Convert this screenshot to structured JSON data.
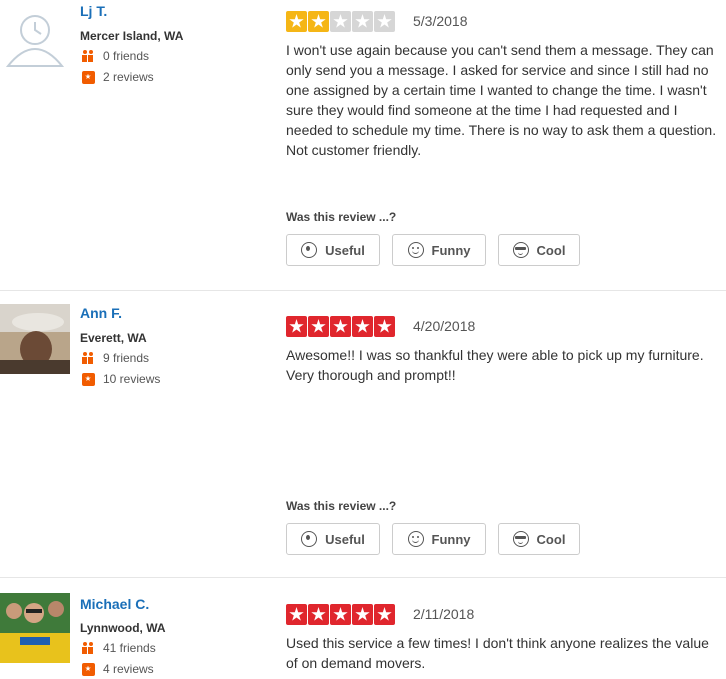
{
  "reviews": [
    {
      "user": {
        "name": "Lj T.",
        "location": "Mercer Island, WA",
        "friends": "0 friends",
        "reviews": "2 reviews",
        "avatar": "default-avatar"
      },
      "rating": 2,
      "star_color": "#f5b616",
      "date": "5/3/2018",
      "text": "I won't use again because you can't send them a message. They can only send you a message. I asked for service and since I still had no one assigned by a certain time I wanted to change the time. I wasn't sure they would find someone at the time I had requested and I needed to schedule my time. There is no way to ask them a question. Not customer friendly.",
      "was_this": "Was this review ...?",
      "buttons": {
        "useful": "Useful",
        "funny": "Funny",
        "cool": "Cool"
      }
    },
    {
      "user": {
        "name": "Ann F.",
        "location": "Everett, WA",
        "friends": "9 friends",
        "reviews": "10 reviews",
        "avatar": "user-photo"
      },
      "rating": 5,
      "star_color": "#e0262d",
      "date": "4/20/2018",
      "text": "Awesome!! I was so thankful they were able to pick up my furniture. Very thorough and prompt!!",
      "was_this": "Was this review ...?",
      "buttons": {
        "useful": "Useful",
        "funny": "Funny",
        "cool": "Cool"
      }
    },
    {
      "user": {
        "name": "Michael C.",
        "location": "Lynnwood, WA",
        "friends": "41 friends",
        "reviews": "4 reviews",
        "avatar": "user-photo"
      },
      "rating": 5,
      "star_color": "#e0262d",
      "date": "2/11/2018",
      "text": "Used this service a few times! I don't think anyone realizes the value of on demand movers."
    }
  ],
  "colors": {
    "link": "#1a6fb8",
    "accent": "#f15c00",
    "star_empty": "#d6d6d6"
  }
}
